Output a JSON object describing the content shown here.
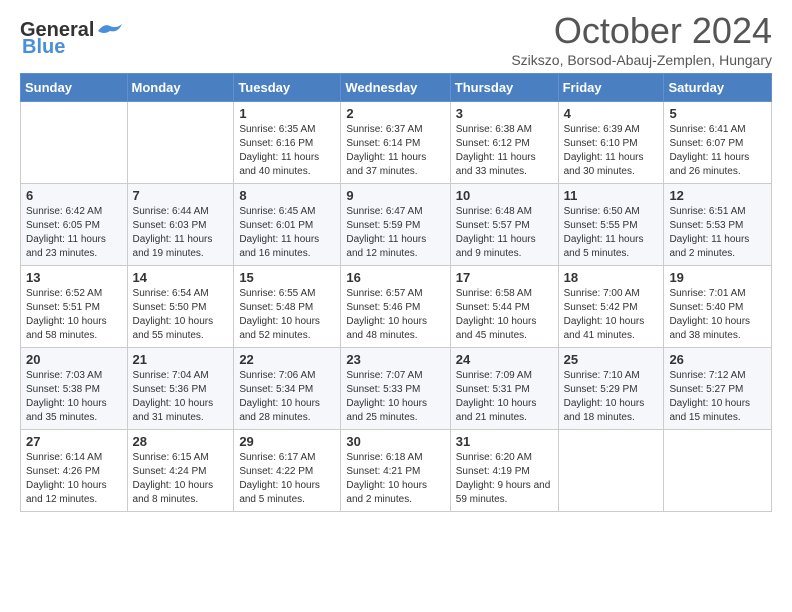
{
  "header": {
    "logo_general": "General",
    "logo_blue": "Blue",
    "month": "October 2024",
    "location": "Szikszo, Borsod-Abauj-Zemplen, Hungary"
  },
  "days_of_week": [
    "Sunday",
    "Monday",
    "Tuesday",
    "Wednesday",
    "Thursday",
    "Friday",
    "Saturday"
  ],
  "weeks": [
    [
      {
        "day": "",
        "sunrise": "",
        "sunset": "",
        "daylight": ""
      },
      {
        "day": "",
        "sunrise": "",
        "sunset": "",
        "daylight": ""
      },
      {
        "day": "1",
        "sunrise": "Sunrise: 6:35 AM",
        "sunset": "Sunset: 6:16 PM",
        "daylight": "Daylight: 11 hours and 40 minutes."
      },
      {
        "day": "2",
        "sunrise": "Sunrise: 6:37 AM",
        "sunset": "Sunset: 6:14 PM",
        "daylight": "Daylight: 11 hours and 37 minutes."
      },
      {
        "day": "3",
        "sunrise": "Sunrise: 6:38 AM",
        "sunset": "Sunset: 6:12 PM",
        "daylight": "Daylight: 11 hours and 33 minutes."
      },
      {
        "day": "4",
        "sunrise": "Sunrise: 6:39 AM",
        "sunset": "Sunset: 6:10 PM",
        "daylight": "Daylight: 11 hours and 30 minutes."
      },
      {
        "day": "5",
        "sunrise": "Sunrise: 6:41 AM",
        "sunset": "Sunset: 6:07 PM",
        "daylight": "Daylight: 11 hours and 26 minutes."
      }
    ],
    [
      {
        "day": "6",
        "sunrise": "Sunrise: 6:42 AM",
        "sunset": "Sunset: 6:05 PM",
        "daylight": "Daylight: 11 hours and 23 minutes."
      },
      {
        "day": "7",
        "sunrise": "Sunrise: 6:44 AM",
        "sunset": "Sunset: 6:03 PM",
        "daylight": "Daylight: 11 hours and 19 minutes."
      },
      {
        "day": "8",
        "sunrise": "Sunrise: 6:45 AM",
        "sunset": "Sunset: 6:01 PM",
        "daylight": "Daylight: 11 hours and 16 minutes."
      },
      {
        "day": "9",
        "sunrise": "Sunrise: 6:47 AM",
        "sunset": "Sunset: 5:59 PM",
        "daylight": "Daylight: 11 hours and 12 minutes."
      },
      {
        "day": "10",
        "sunrise": "Sunrise: 6:48 AM",
        "sunset": "Sunset: 5:57 PM",
        "daylight": "Daylight: 11 hours and 9 minutes."
      },
      {
        "day": "11",
        "sunrise": "Sunrise: 6:50 AM",
        "sunset": "Sunset: 5:55 PM",
        "daylight": "Daylight: 11 hours and 5 minutes."
      },
      {
        "day": "12",
        "sunrise": "Sunrise: 6:51 AM",
        "sunset": "Sunset: 5:53 PM",
        "daylight": "Daylight: 11 hours and 2 minutes."
      }
    ],
    [
      {
        "day": "13",
        "sunrise": "Sunrise: 6:52 AM",
        "sunset": "Sunset: 5:51 PM",
        "daylight": "Daylight: 10 hours and 58 minutes."
      },
      {
        "day": "14",
        "sunrise": "Sunrise: 6:54 AM",
        "sunset": "Sunset: 5:50 PM",
        "daylight": "Daylight: 10 hours and 55 minutes."
      },
      {
        "day": "15",
        "sunrise": "Sunrise: 6:55 AM",
        "sunset": "Sunset: 5:48 PM",
        "daylight": "Daylight: 10 hours and 52 minutes."
      },
      {
        "day": "16",
        "sunrise": "Sunrise: 6:57 AM",
        "sunset": "Sunset: 5:46 PM",
        "daylight": "Daylight: 10 hours and 48 minutes."
      },
      {
        "day": "17",
        "sunrise": "Sunrise: 6:58 AM",
        "sunset": "Sunset: 5:44 PM",
        "daylight": "Daylight: 10 hours and 45 minutes."
      },
      {
        "day": "18",
        "sunrise": "Sunrise: 7:00 AM",
        "sunset": "Sunset: 5:42 PM",
        "daylight": "Daylight: 10 hours and 41 minutes."
      },
      {
        "day": "19",
        "sunrise": "Sunrise: 7:01 AM",
        "sunset": "Sunset: 5:40 PM",
        "daylight": "Daylight: 10 hours and 38 minutes."
      }
    ],
    [
      {
        "day": "20",
        "sunrise": "Sunrise: 7:03 AM",
        "sunset": "Sunset: 5:38 PM",
        "daylight": "Daylight: 10 hours and 35 minutes."
      },
      {
        "day": "21",
        "sunrise": "Sunrise: 7:04 AM",
        "sunset": "Sunset: 5:36 PM",
        "daylight": "Daylight: 10 hours and 31 minutes."
      },
      {
        "day": "22",
        "sunrise": "Sunrise: 7:06 AM",
        "sunset": "Sunset: 5:34 PM",
        "daylight": "Daylight: 10 hours and 28 minutes."
      },
      {
        "day": "23",
        "sunrise": "Sunrise: 7:07 AM",
        "sunset": "Sunset: 5:33 PM",
        "daylight": "Daylight: 10 hours and 25 minutes."
      },
      {
        "day": "24",
        "sunrise": "Sunrise: 7:09 AM",
        "sunset": "Sunset: 5:31 PM",
        "daylight": "Daylight: 10 hours and 21 minutes."
      },
      {
        "day": "25",
        "sunrise": "Sunrise: 7:10 AM",
        "sunset": "Sunset: 5:29 PM",
        "daylight": "Daylight: 10 hours and 18 minutes."
      },
      {
        "day": "26",
        "sunrise": "Sunrise: 7:12 AM",
        "sunset": "Sunset: 5:27 PM",
        "daylight": "Daylight: 10 hours and 15 minutes."
      }
    ],
    [
      {
        "day": "27",
        "sunrise": "Sunrise: 6:14 AM",
        "sunset": "Sunset: 4:26 PM",
        "daylight": "Daylight: 10 hours and 12 minutes."
      },
      {
        "day": "28",
        "sunrise": "Sunrise: 6:15 AM",
        "sunset": "Sunset: 4:24 PM",
        "daylight": "Daylight: 10 hours and 8 minutes."
      },
      {
        "day": "29",
        "sunrise": "Sunrise: 6:17 AM",
        "sunset": "Sunset: 4:22 PM",
        "daylight": "Daylight: 10 hours and 5 minutes."
      },
      {
        "day": "30",
        "sunrise": "Sunrise: 6:18 AM",
        "sunset": "Sunset: 4:21 PM",
        "daylight": "Daylight: 10 hours and 2 minutes."
      },
      {
        "day": "31",
        "sunrise": "Sunrise: 6:20 AM",
        "sunset": "Sunset: 4:19 PM",
        "daylight": "Daylight: 9 hours and 59 minutes."
      },
      {
        "day": "",
        "sunrise": "",
        "sunset": "",
        "daylight": ""
      },
      {
        "day": "",
        "sunrise": "",
        "sunset": "",
        "daylight": ""
      }
    ]
  ]
}
